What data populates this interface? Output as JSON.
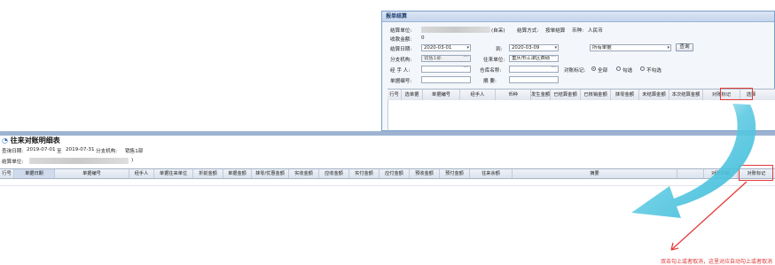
{
  "dialog": {
    "title": "报单结算",
    "settle_unit_label": "结算单位:",
    "settle_unit_suffix": "(自采)",
    "settle_method_label": "结算方式:",
    "settle_method_value": "按单结算",
    "currency_label": "币种:",
    "currency_value": "人民币",
    "received_label": "收款金额:",
    "received_value": "0",
    "date_label": "结算日期:",
    "date_from": "2020-03-01",
    "date_to_label": "到:",
    "date_to": "2020-03-09",
    "doc_type_value": "所有单据",
    "search_button": "查询",
    "branch_label": "分支机构:",
    "branch_value": "销售1部",
    "partner_label": "往来单位:",
    "partner_value": "重庆市江津区赛硕",
    "handler_label": "经 手 人:",
    "warehouse_label": "仓库名称:",
    "flag_label": "对账标记:",
    "radio_all": "全部",
    "radio_checked": "勾选",
    "radio_unchecked": "不勾选",
    "doc_no_label": "单据编号:",
    "summary_label": "摘 要:",
    "grid_headers": [
      "行号",
      "选单据",
      "单据编号",
      "经手人",
      "币种",
      "发生金额",
      "已结算金额",
      "已核销金额",
      "抹零金额",
      "未结算金额",
      "本次结算金额",
      "对账标记",
      "选择"
    ]
  },
  "report": {
    "title": "往来对账明细表",
    "query_date_label": "查询日期:",
    "date_from": "2019-07-01",
    "to_label": "至",
    "date_to": "2019-07-31",
    "branch_label": "分支机构:",
    "branch_value": "销售1部",
    "settle_unit_label": "结算单位:",
    "settle_unit_close": ")",
    "grid_headers": [
      "行号",
      "单据日期",
      "单据编号",
      "经手人",
      "单据往来单位",
      "折前金额",
      "单据金额",
      "抹零/优惠金额",
      "实收金额",
      "应收金额",
      "实付金额",
      "应付金额",
      "预收金额",
      "预付金额",
      "往来余额",
      "摘要",
      "",
      "对账日期",
      "对账标记"
    ]
  },
  "annotation": {
    "text": "双击勾上或者取消，这里对应自动勾上或者取消"
  },
  "colors": {
    "accent_red": "#e53a3a",
    "arrow": "#3cc0dc",
    "header_blue": "#9db3d1"
  }
}
